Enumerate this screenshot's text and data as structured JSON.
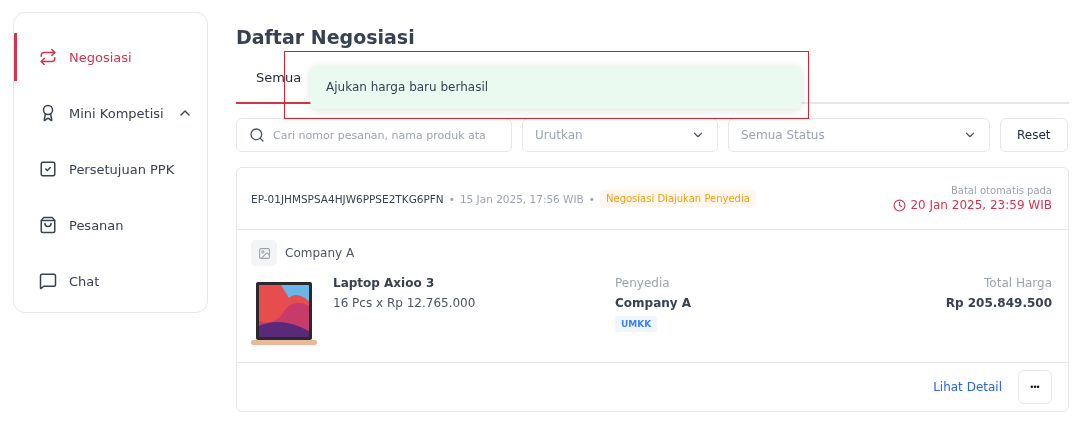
{
  "sidebar": {
    "items": [
      {
        "kind": "swap",
        "label": "Negosiasi",
        "selected": true
      },
      {
        "kind": "award",
        "label": "Mini Kompetisi",
        "selected": false,
        "expanded": true
      },
      {
        "kind": "check",
        "label": "Persetujuan PPK",
        "selected": false
      },
      {
        "kind": "bag",
        "label": "Pesanan",
        "selected": false
      },
      {
        "kind": "chat",
        "label": "Chat",
        "selected": false
      }
    ]
  },
  "title": "Daftar Negosiasi",
  "tabs": [
    {
      "label": "Semua",
      "selected": true
    }
  ],
  "toast": {
    "message": "Ajukan harga baru berhasil"
  },
  "filters": {
    "search": {
      "placeholder": "Cari nomor pesanan, nama produk ata"
    },
    "sort": {
      "placeholder": "Urutkan"
    },
    "status": {
      "placeholder": "Semua Status"
    },
    "reset": "Reset"
  },
  "orders": [
    {
      "number": "EP-01JHMSPSA4HJW6PPSE2TKG6PFN",
      "separator": "•",
      "date": "15 Jan 2025, 17:56 WIB",
      "status": "Negosiasi Diajukan Penyedia",
      "deadline_label": "Batal otomatis pada",
      "deadline": "20 Jan 2025, 23:59 WIB",
      "company": "Company A",
      "product": {
        "name": "Laptop Axioo 3",
        "qty": "16 Pcs x Rp 12.765.000"
      },
      "supplier_label": "Penyedia",
      "supplier": "Company A",
      "supplier_tag": "UMKK",
      "total_label": "Total Harga",
      "total": "Rp 205.849.500",
      "detail_link": "Lihat Detail",
      "more": "•••"
    }
  ]
}
